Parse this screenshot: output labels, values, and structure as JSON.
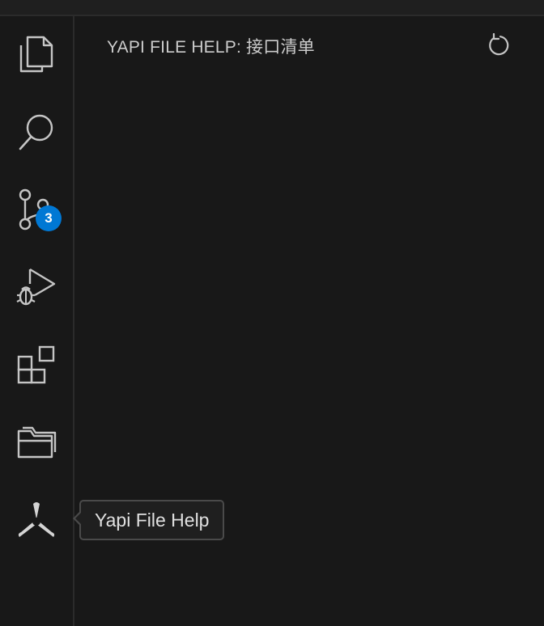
{
  "theme": {
    "background": "#181818",
    "border": "#2b2b2b",
    "icon_color": "#cccccc",
    "badge_color": "#0078d4",
    "text_color": "#cccccc"
  },
  "activity_bar": {
    "items": [
      {
        "name": "explorer",
        "icon": "files-icon"
      },
      {
        "name": "search",
        "icon": "search-icon"
      },
      {
        "name": "source-control",
        "icon": "source-control-icon",
        "badge": "3"
      },
      {
        "name": "run-and-debug",
        "icon": "debug-alt-icon"
      },
      {
        "name": "extensions",
        "icon": "extensions-icon"
      },
      {
        "name": "folders",
        "icon": "folders-icon"
      },
      {
        "name": "yapi-file-help",
        "icon": "yapi-logo-icon",
        "tooltip": "Yapi File Help"
      }
    ]
  },
  "sidebar": {
    "title": "YAPI FILE HELP: 接口清单",
    "refresh_icon": "refresh-icon"
  }
}
